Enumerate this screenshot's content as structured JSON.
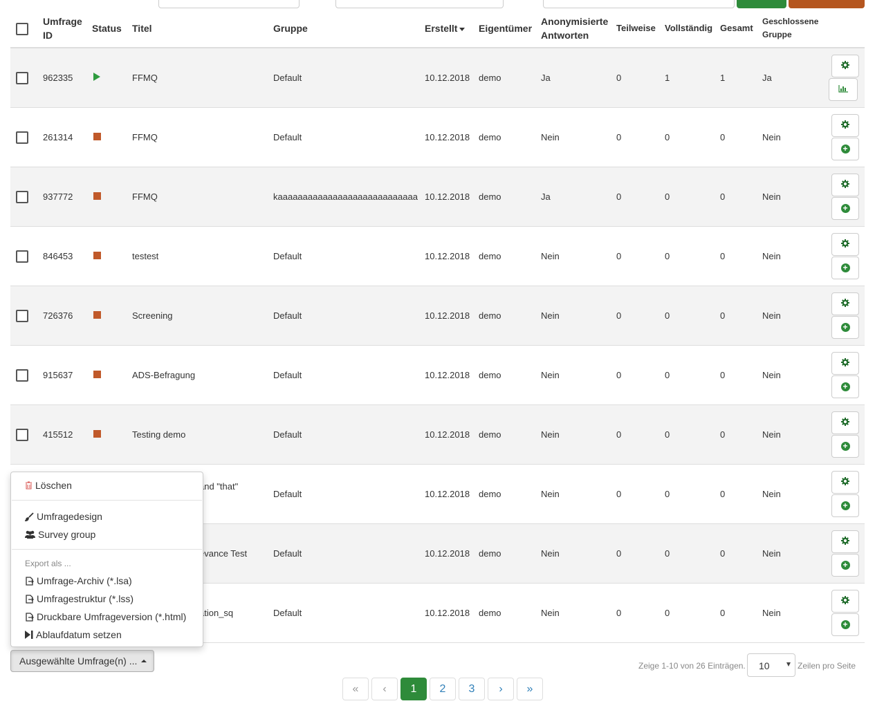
{
  "table": {
    "headers": {
      "survey_id": "Umfrage ID",
      "status": "Status",
      "title": "Titel",
      "group": "Gruppe",
      "created": "Erstellt",
      "owner": "Eigentümer",
      "anonymized": "Anonymisierte Antworten",
      "partial": "Teilweise",
      "full": "Vollständig",
      "total": "Gesamt",
      "closed_group": "Geschlossene Gruppe"
    },
    "rows": [
      {
        "id": "962335",
        "status": "active",
        "title": "FFMQ",
        "group": "Default",
        "created": "10.12.2018",
        "owner": "demo",
        "anonymized": "Ja",
        "partial": "0",
        "full": "1",
        "total": "1",
        "closed": "Ja"
      },
      {
        "id": "261314",
        "status": "inactive",
        "title": "FFMQ",
        "group": "Default",
        "created": "10.12.2018",
        "owner": "demo",
        "anonymized": "Nein",
        "partial": "0",
        "full": "0",
        "total": "0",
        "closed": "Nein"
      },
      {
        "id": "937772",
        "status": "inactive",
        "title": "FFMQ",
        "group": "kaaaaaaaaaaaaaaaaaaaaaaaaaaaa",
        "created": "10.12.2018",
        "owner": "demo",
        "anonymized": "Ja",
        "partial": "0",
        "full": "0",
        "total": "0",
        "closed": "Nein"
      },
      {
        "id": "846453",
        "status": "inactive",
        "title": "testest",
        "group": "Default",
        "created": "10.12.2018",
        "owner": "demo",
        "anonymized": "Nein",
        "partial": "0",
        "full": "0",
        "total": "0",
        "closed": "Nein"
      },
      {
        "id": "726376",
        "status": "inactive",
        "title": "Screening",
        "group": "Default",
        "created": "10.12.2018",
        "owner": "demo",
        "anonymized": "Nein",
        "partial": "0",
        "full": "0",
        "total": "0",
        "closed": "Nein"
      },
      {
        "id": "915637",
        "status": "inactive",
        "title": "ADS-Befragung",
        "group": "Default",
        "created": "10.12.2018",
        "owner": "demo",
        "anonymized": "Nein",
        "partial": "0",
        "full": "0",
        "total": "0",
        "closed": "Nein"
      },
      {
        "id": "415512",
        "status": "inactive",
        "title": "Testing demo",
        "group": "Default",
        "created": "10.12.2018",
        "owner": "demo",
        "anonymized": "Nein",
        "partial": "0",
        "full": "0",
        "total": "0",
        "closed": "Nein"
      },
      {
        "id": "",
        "status": "",
        "title": "and \"that\"",
        "group": "Default",
        "created": "10.12.2018",
        "owner": "demo",
        "anonymized": "Nein",
        "partial": "0",
        "full": "0",
        "total": "0",
        "closed": "Nein"
      },
      {
        "id": "",
        "status": "",
        "title": "evance Test",
        "group": "Default",
        "created": "10.12.2018",
        "owner": "demo",
        "anonymized": "Nein",
        "partial": "0",
        "full": "0",
        "total": "0",
        "closed": "Nein"
      },
      {
        "id": "",
        "status": "",
        "title": "ation_sq",
        "group": "Default",
        "created": "10.12.2018",
        "owner": "demo",
        "anonymized": "Nein",
        "partial": "0",
        "full": "0",
        "total": "0",
        "closed": "Nein"
      }
    ],
    "row_icons": {
      "settings": "gear-icon",
      "statistics": "bar-chart-icon",
      "add": "plus-circle-icon"
    }
  },
  "menu": {
    "delete": "Löschen",
    "design": "Umfragedesign",
    "survey_group": "Survey group",
    "export_header": "Export als ...",
    "export_archive": "Umfrage-Archiv (*.lsa)",
    "export_structure": "Umfragestruktur (*.lss)",
    "export_printable": "Druckbare Umfrageversion (*.html)",
    "expiry": "Ablaufdatum setzen"
  },
  "bulk_button": "Ausgewählte Umfrage(n) ...",
  "footer": {
    "summary": "Zeige 1-10 von 26 Einträgen.",
    "page_size": "10",
    "page_size_label": "Zeilen pro Seite"
  },
  "pagination": {
    "first": "«",
    "prev": "‹",
    "pages": [
      "1",
      "2",
      "3"
    ],
    "next": "›",
    "last": "»",
    "current": "1"
  },
  "colors": {
    "accent_green": "#2e8b3a",
    "status_stopped": "#c0592a",
    "status_active": "#2e9b3e",
    "top_orange": "#b5561f",
    "link_blue": "#2f7fb8"
  }
}
